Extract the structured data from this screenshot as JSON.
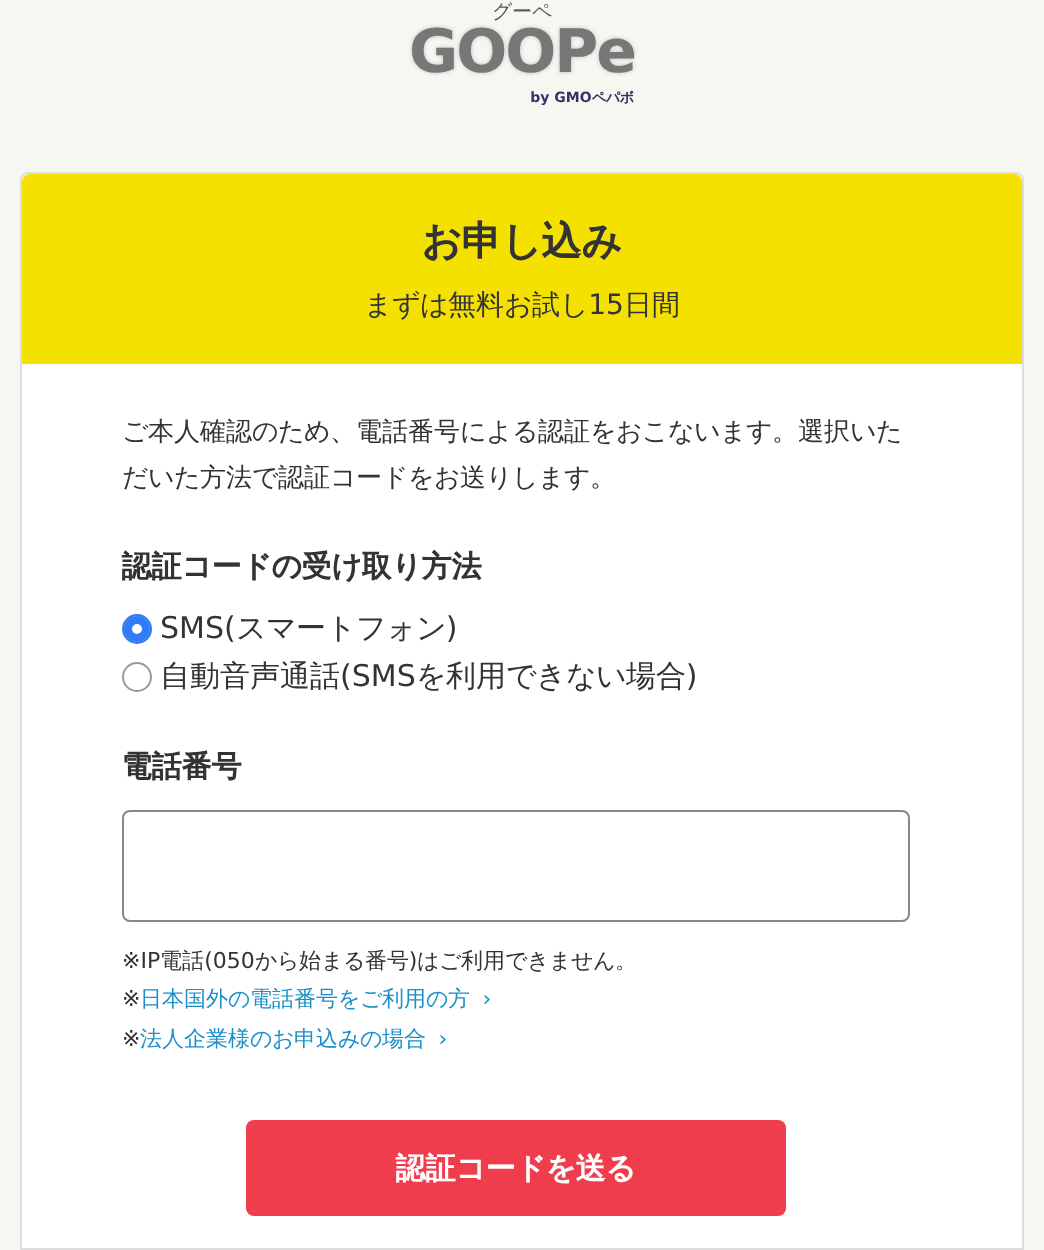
{
  "logo": {
    "kana": "グーペ",
    "wordmark": "GOOPe",
    "byline": "by GMOペパボ"
  },
  "header": {
    "title": "お申し込み",
    "subtitle": "まずは無料お試し15日間"
  },
  "intro": "ご本人確認のため、電話番号による認証をおこないます。選択いただいた方法で認証コードをお送りします。",
  "method": {
    "heading": "認証コードの受け取り方法",
    "options": [
      {
        "label": "SMS(スマートフォン)",
        "selected": true
      },
      {
        "label": "自動音声通話(SMSを利用できない場合)",
        "selected": false
      }
    ]
  },
  "phone": {
    "label": "電話番号"
  },
  "notes": [
    {
      "kind": "text",
      "mark": "※",
      "text": "IP電話(050から始まる番号)はご利用できません。"
    },
    {
      "kind": "link",
      "mark": "※",
      "text": "日本国外の電話番号をご利用の方",
      "chevron": "›"
    },
    {
      "kind": "link",
      "mark": "※",
      "text": "法人企業様のお申込みの場合",
      "chevron": "›"
    }
  ],
  "submit": "認証コードを送る"
}
